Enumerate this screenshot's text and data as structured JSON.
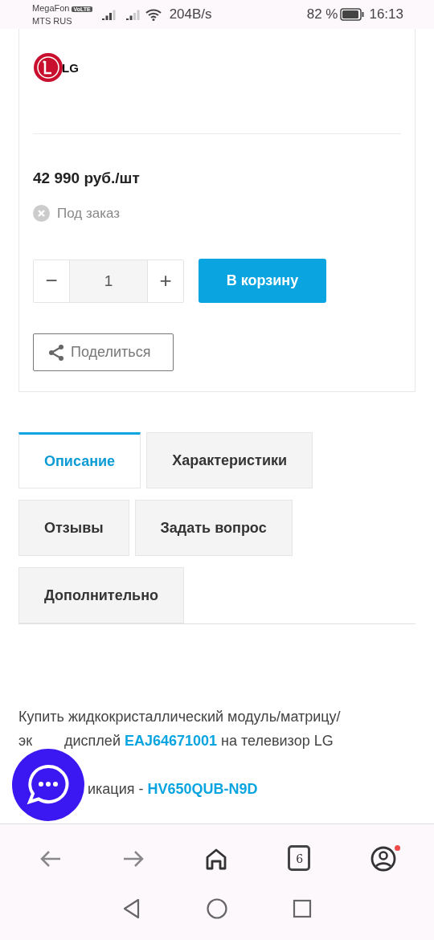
{
  "status_bar": {
    "carrier_1": "MegaFon",
    "volte": "VoLTE",
    "carrier_2": "MTS RUS",
    "speed": "204B/s",
    "battery": "82 %",
    "time": "16:13"
  },
  "product": {
    "brand_logo": "LG",
    "price": "42 990 руб./шт",
    "availability": "Под заказ",
    "quantity": "1",
    "decrement": "−",
    "increment": "+",
    "cart_button": "В корзину",
    "share_button": "Поделиться"
  },
  "tabs": [
    {
      "label": "Описание",
      "selected": true
    },
    {
      "label": "Характеристики",
      "selected": false
    },
    {
      "label": "Отзывы",
      "selected": false
    },
    {
      "label": "Задать вопрос",
      "selected": false
    },
    {
      "label": "Дополнительно",
      "selected": false
    }
  ],
  "description": [
    [
      {
        "kind": "text",
        "text": "Купить жидкокристаллический модуль/матрицу/"
      },
      {
        "kind": "break"
      },
      {
        "kind": "text",
        "text": "эк"
      },
      {
        "kind": "covered"
      },
      {
        "kind": "text",
        "text": "дисплей "
      },
      {
        "kind": "link",
        "text": "EAJ64671001"
      },
      {
        "kind": "text",
        "text": " на телевизор LG"
      }
    ],
    [
      {
        "kind": "covered"
      },
      {
        "kind": "text",
        "text": "икация - "
      },
      {
        "kind": "link",
        "text": "HV650QUB-N9D"
      }
    ]
  ],
  "browser_bar": {
    "tab_count": "6",
    "notification": true
  }
}
